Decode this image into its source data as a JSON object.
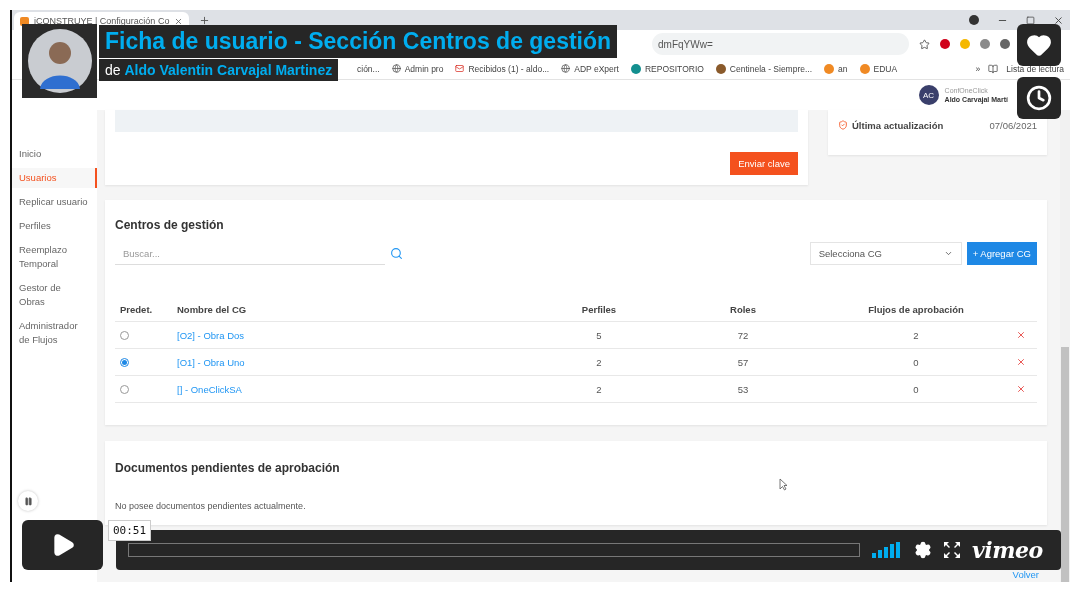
{
  "player": {
    "title": "Ficha de usuario - Sección Centros de gestión",
    "byline_prefix": "de",
    "author": "Aldo Valentin Carvajal Martinez",
    "time": "00:51",
    "logo": "vimeo",
    "progress": {
      "level": 0
    }
  },
  "browser": {
    "tab_title": "iCONSTRUYE | Configuración Co",
    "url": "dmFqYWw=",
    "bookmarks": [
      "ción...",
      "Admin pro",
      "Recibidos (1) - aldo...",
      "ADP eXpert",
      "REPOSITORIO",
      "Centinela - Siempre...",
      "an",
      "EDUA"
    ],
    "overflow": "»",
    "reading_list": "Lista de lectura"
  },
  "app": {
    "account": {
      "initials": "AC",
      "org": "ConfOneClick",
      "user": "Aldo Carvajal Martí"
    },
    "sidebar": [
      {
        "label": "Inicio",
        "selected": false
      },
      {
        "label": "Usuarios",
        "selected": true
      },
      {
        "label": "Replicar usuario",
        "selected": false
      },
      {
        "label": "Perfiles",
        "selected": false
      },
      {
        "label": "Reemplazo Temporal",
        "selected": false
      },
      {
        "label": "Gestor de Obras",
        "selected": false
      },
      {
        "label": "Administrador de Flujos",
        "selected": false
      }
    ],
    "send_key_button": "Enviar clave",
    "last_update": {
      "label": "Última actualización",
      "value": "07/06/2021"
    },
    "centers": {
      "title": "Centros de gestión",
      "search_placeholder": "Buscar...",
      "select_placeholder": "Selecciona CG",
      "add_button": "+ Agregar CG",
      "columns": [
        "Predet.",
        "Nombre del CG",
        "Perfiles",
        "Roles",
        "Flujos de aprobación"
      ],
      "rows": [
        {
          "selected": false,
          "name": "[O2] - Obra Dos",
          "profiles": "5",
          "roles": "72",
          "flows": "2"
        },
        {
          "selected": true,
          "name": "[O1] - Obra Uno",
          "profiles": "2",
          "roles": "57",
          "flows": "0"
        },
        {
          "selected": false,
          "name": "[] - OneClickSA",
          "profiles": "2",
          "roles": "53",
          "flows": "0"
        }
      ]
    },
    "pending": {
      "title": "Documentos pendientes de aprobación",
      "empty": "No posee documentos pendientes actualmente."
    },
    "back_link": "Volver"
  }
}
